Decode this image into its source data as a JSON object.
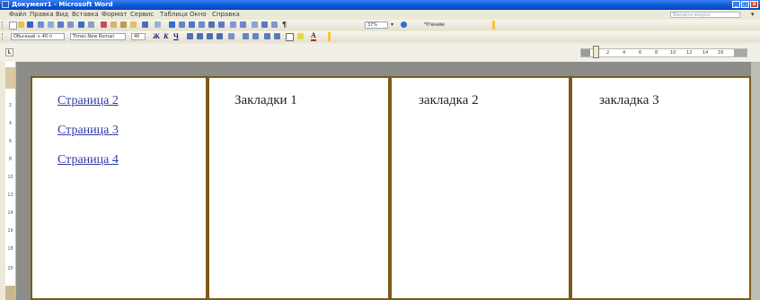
{
  "window": {
    "title": "Документ1 - Microsoft Word",
    "controls": [
      "_",
      "□",
      "x"
    ]
  },
  "menu": {
    "items": [
      "Файл",
      "Правка",
      "Вид",
      "Вставка",
      "Формат",
      "Сервис",
      "Таблица",
      "Окно",
      "Справка"
    ],
    "help_placeholder": "Введите вопрос"
  },
  "toolbar_standard": {
    "zoom": "37%",
    "read_label": "Чтение"
  },
  "toolbar_format": {
    "style": "Обычный + 40 п",
    "font": "Times New Roman",
    "size": "40",
    "bold": "Ж",
    "italic": "К",
    "underline": "Ч"
  },
  "ruler": {
    "tab_selector": "L",
    "ticks": [
      "2",
      "4",
      "6",
      "8",
      "10",
      "12",
      "14",
      "16"
    ],
    "vertical_ticks": [
      "2",
      "4",
      "6",
      "8",
      "10",
      "12",
      "14",
      "16",
      "18",
      "20"
    ]
  },
  "pages": [
    {
      "links": [
        "Страница 2",
        "Страница 3",
        "Страница 4"
      ]
    },
    {
      "text": "Закладки 1"
    },
    {
      "text": "закладка 2"
    },
    {
      "text": "закладка 3"
    }
  ]
}
